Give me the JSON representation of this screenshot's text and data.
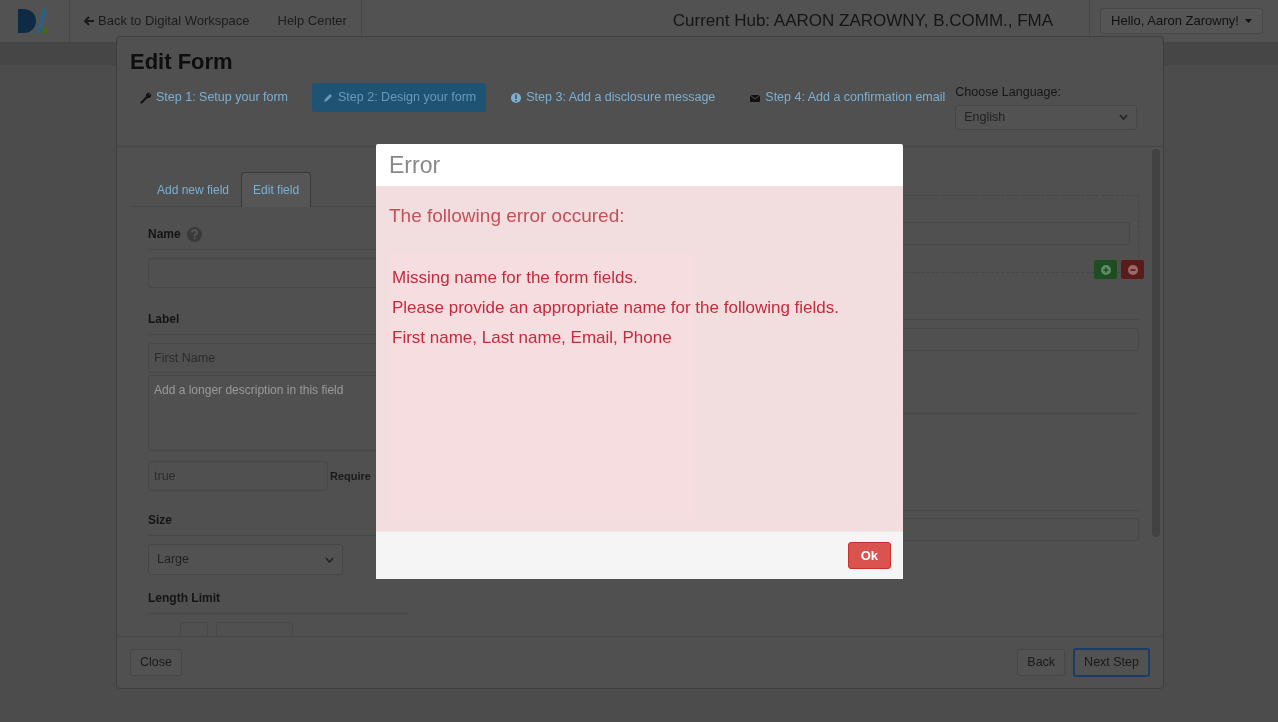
{
  "navbar": {
    "back_link": "Back to Digital Workspace",
    "help_link": "Help Center",
    "current_hub": "Current Hub: AARON ZAROWNY, B.COMM., FMA",
    "user_menu": "Hello, Aaron Zarowny!"
  },
  "edit_form": {
    "title": "Edit Form",
    "steps": [
      {
        "label": "Step 1: Setup your form",
        "selected": false
      },
      {
        "label": "Step 2: Design your form",
        "selected": true
      },
      {
        "label": "Step 3: Add a disclosure message",
        "selected": false
      },
      {
        "label": "Step 4: Add a confirmation email",
        "selected": false
      }
    ],
    "language": {
      "label": "Choose Language:",
      "value": "English"
    },
    "field_tabs": [
      {
        "label": "Add new field",
        "selected": false
      },
      {
        "label": "Edit field",
        "selected": true
      }
    ],
    "name_label": "Name",
    "label_heading": "Label",
    "label_value": "First Name",
    "description_placeholder": "Add a longer description in this field",
    "required_value": "true",
    "required_label": "Require",
    "size_label": "Size",
    "size_value": "Large",
    "length_limit_label": "Length Limit",
    "buttons": {
      "close": "Close",
      "back": "Back",
      "next": "Next Step"
    }
  },
  "error_dialog": {
    "title": "Error",
    "intro": "The following error occured:",
    "messages": [
      "Missing name for the form fields.",
      "Please provide an appropriate name for the following fields.",
      "First name, Last name, Email, Phone"
    ],
    "button": "Ok"
  }
}
